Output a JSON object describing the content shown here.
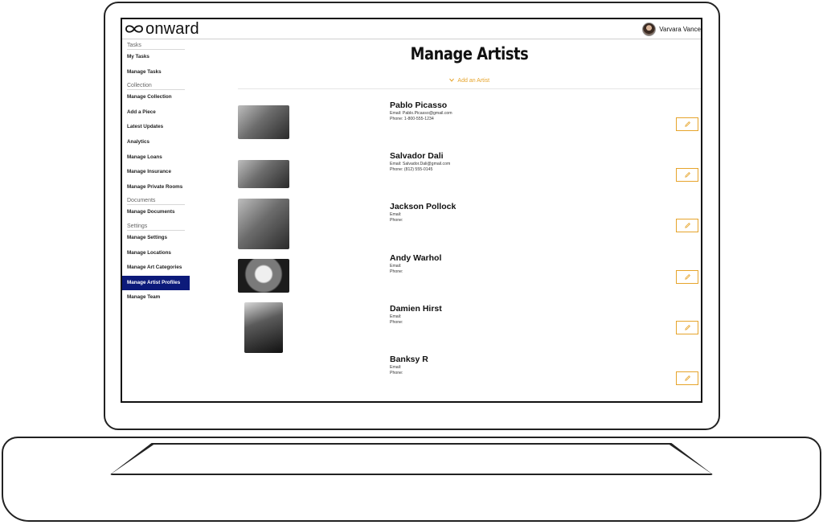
{
  "header": {
    "logo_text": "onward",
    "user_name": "Varvara Vance"
  },
  "sidebar": {
    "sections": [
      {
        "title": "Tasks",
        "items": [
          "My Tasks",
          "Manage Tasks"
        ]
      },
      {
        "title": "Collection",
        "items": [
          "Manage Collection",
          "Add a Piece",
          "Latest Updates",
          "Analytics",
          "Manage Loans",
          "Manage Insurance",
          "Manage Private Rooms"
        ]
      },
      {
        "title": "Documents",
        "items": [
          "Manage Documents"
        ]
      },
      {
        "title": "Settings",
        "items": [
          "Manage Settings",
          "Manage Locations",
          "Manage Art Categories",
          "Manage Artist Profiles",
          "Manage Team"
        ]
      }
    ],
    "active_item": "Manage Artist Profiles"
  },
  "main": {
    "title": "Manage Artists",
    "add_label": "Add an Artist",
    "artists": [
      {
        "name": "Pablo Picasso",
        "email": "Email: Pablo.Picasso@gmail.com",
        "phone": "Phone: 1-800-555-1234"
      },
      {
        "name": "Salvador Dali",
        "email": "Email: Salvador.Dali@gmail.com",
        "phone": "Phone: (812) 555-0145"
      },
      {
        "name": "Jackson Pollock",
        "email": "Email:",
        "phone": "Phone:"
      },
      {
        "name": "Andy Warhol",
        "email": "Email:",
        "phone": "Phone:"
      },
      {
        "name": "Damien Hirst",
        "email": "Email:",
        "phone": "Phone:"
      },
      {
        "name": "Banksy R",
        "email": "Email:",
        "phone": "Phone:"
      }
    ]
  },
  "colors": {
    "accent": "#e6a42b",
    "active_nav": "#0c1a7a"
  },
  "icons": {
    "logo": "infinity-icon",
    "add": "chevron-down-icon",
    "edit": "pencil-icon"
  }
}
